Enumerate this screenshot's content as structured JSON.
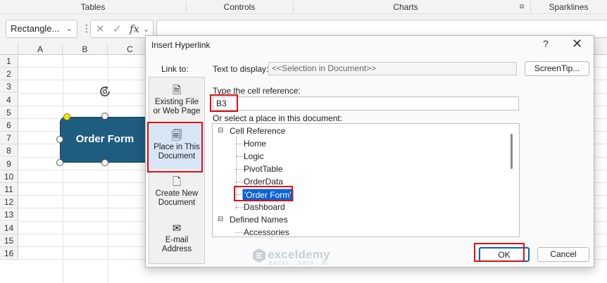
{
  "ribbon": {
    "groups": [
      "Tables",
      "Controls",
      "Charts",
      "Sparklines"
    ]
  },
  "formula_bar": {
    "name_box": "Rectangle...",
    "cancel_glyph": "✕",
    "enter_glyph": "✓",
    "fx_glyph": "fx"
  },
  "grid": {
    "columns": [
      "A",
      "B",
      "C"
    ],
    "rows": [
      "1",
      "2",
      "3",
      "4",
      "5",
      "6",
      "7",
      "8",
      "9",
      "10",
      "11",
      "12",
      "13",
      "14",
      "15",
      "16"
    ]
  },
  "shape": {
    "label": "Order Form",
    "fill": "#1f5d80"
  },
  "dialog": {
    "title": "Insert Hyperlink",
    "help": "?",
    "close": "✕",
    "link_to_label": "Link to:",
    "link_to": [
      {
        "line1": "Existing File",
        "line2": "or Web Page"
      },
      {
        "line1": "Place in This",
        "line2": "Document"
      },
      {
        "line1": "Create New",
        "line2": "Document"
      },
      {
        "line1": "E-mail",
        "line2": "Address"
      }
    ],
    "text_to_display_label": "Text to display:",
    "text_to_display_value": "<<Selection in Document>>",
    "screentip_label": "ScreenTip...",
    "cell_ref_label": "Type the cell reference:",
    "cell_ref_value": "B3",
    "select_place_label": "Or select a place in this document:",
    "tree": {
      "cell_reference": "Cell Reference",
      "sheets": [
        "Home",
        "Logic",
        "PivotTable",
        "OrderData",
        "'Order Form'",
        "Dashboard"
      ],
      "defined_names": "Defined Names",
      "names": [
        "Accessories"
      ]
    },
    "ok_label": "OK",
    "cancel_label": "Cancel"
  },
  "watermark": {
    "name": "exceldemy",
    "tagline": "EXCEL · DATA · BI"
  }
}
